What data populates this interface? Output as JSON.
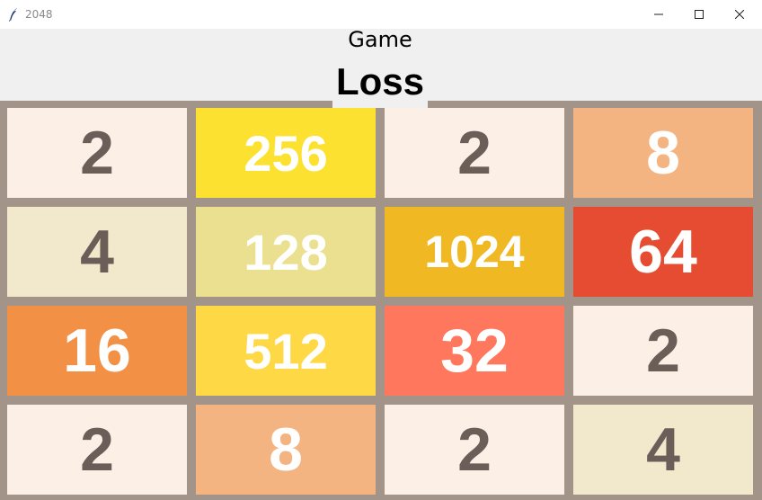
{
  "window": {
    "title": "2048",
    "icons": {
      "app": "feather-icon",
      "minimize": "minimize-icon",
      "maximize": "maximize-icon",
      "close": "close-icon"
    }
  },
  "header": {
    "game_label": "Game",
    "status": "Loss"
  },
  "board": {
    "size": 4,
    "colors": {
      "background": "#a39489",
      "dark_text": "#6b5e58",
      "light_text": "#ffffff"
    },
    "rows": [
      [
        {
          "value": "2",
          "bg": "#fcefe6",
          "fg": "#6b5e58"
        },
        {
          "value": "256",
          "bg": "#fce130",
          "fg": "#ffffff"
        },
        {
          "value": "2",
          "bg": "#fcefe6",
          "fg": "#6b5e58"
        },
        {
          "value": "8",
          "bg": "#f4b482",
          "fg": "#ffffff"
        }
      ],
      [
        {
          "value": "4",
          "bg": "#f2e8cc",
          "fg": "#6b5e58"
        },
        {
          "value": "128",
          "bg": "#ebe08f",
          "fg": "#ffffff"
        },
        {
          "value": "1024",
          "bg": "#f0b823",
          "fg": "#ffffff"
        },
        {
          "value": "64",
          "bg": "#e54c31",
          "fg": "#ffffff"
        }
      ],
      [
        {
          "value": "16",
          "bg": "#f29146",
          "fg": "#ffffff"
        },
        {
          "value": "512",
          "bg": "#ffd945",
          "fg": "#ffffff"
        },
        {
          "value": "32",
          "bg": "#ff775c",
          "fg": "#ffffff"
        },
        {
          "value": "2",
          "bg": "#fcefe6",
          "fg": "#6b5e58"
        }
      ],
      [
        {
          "value": "2",
          "bg": "#fcefe6",
          "fg": "#6b5e58"
        },
        {
          "value": "8",
          "bg": "#f4b482",
          "fg": "#ffffff"
        },
        {
          "value": "2",
          "bg": "#fcefe6",
          "fg": "#6b5e58"
        },
        {
          "value": "4",
          "bg": "#f2e8cc",
          "fg": "#6b5e58"
        }
      ]
    ]
  }
}
